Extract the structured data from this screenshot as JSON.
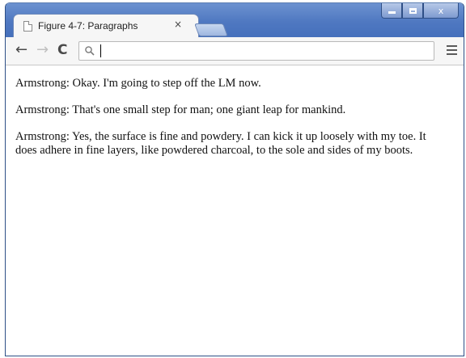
{
  "browser": {
    "tab": {
      "title": "Figure 4-7: Paragraphs",
      "close_label": "×"
    },
    "window_controls": {
      "close_label": "x"
    },
    "toolbar": {
      "back_label": "←",
      "forward_label": "→",
      "reload_label": "C",
      "address_value": ""
    }
  },
  "page": {
    "paragraphs": [
      "Armstrong: Okay. I'm going to step off the LM now.",
      "Armstrong: That's one small step for man; one giant leap for mankind.",
      "Armstrong: Yes, the surface is fine and powdery. I can kick it up loosely with my toe. It does adhere in fine layers, like powdered charcoal, to the sole and sides of my boots."
    ]
  },
  "colors": {
    "titlebar": "#4f78c1",
    "toolbar": "#f6f6f6",
    "text": "#111111"
  },
  "icons": [
    "page-icon",
    "close-icon",
    "minimize-icon",
    "maximize-icon",
    "back-arrow-icon",
    "forward-arrow-icon",
    "reload-icon",
    "search-icon",
    "menu-icon"
  ]
}
